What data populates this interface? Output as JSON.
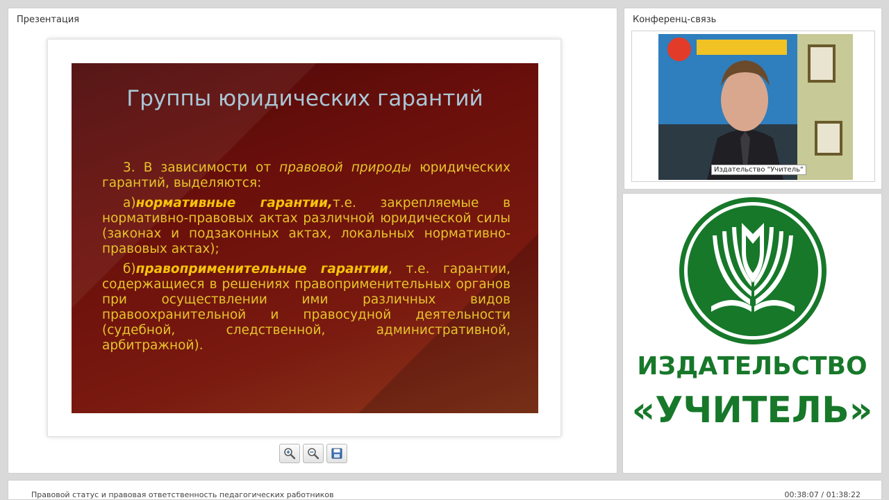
{
  "presentation": {
    "title": "Презентация",
    "slide": {
      "title": "Группы юридических гарантий",
      "intro_num": "3. В зависимости от ",
      "intro_italic": "правовой природы",
      "intro_rest": " юридических гарантий, выделяются:",
      "a_prefix": "а)",
      "a_bold": "нормативные гарантии,",
      "a_rest": "т.е. закрепляемые в нормативно-правовых актах различной юридической силы (законах и подзаконных актах, локальных нормативно-правовых актах);",
      "b_prefix": "б)",
      "b_bold": "правоприменительные гарантии",
      "b_rest": ", т.е. гарантии, содержащиеся в решениях правоприменительных органов при осуществлении ими различных видов правоохранительной и правосудной деятельности (судебной, следственной, административной, арбитражной)."
    },
    "controls": {
      "zoom_in_icon": "zoom-in-icon",
      "zoom_out_icon": "zoom-out-icon",
      "save_icon": "floppy-disk-icon"
    }
  },
  "conference": {
    "title": "Конференц-связь",
    "caption": "Издательство \"Учитель\""
  },
  "publisher": {
    "name": "ИЗДАТЕЛЬСТВО",
    "brand": "«УЧИТЕЛЬ»",
    "logo_icon": "book-logo-icon",
    "color": "#17782a"
  },
  "footer": {
    "lecture_title": "Правовой статус и правовая ответственность педагогических работников",
    "time": "00:38:07 / 01:38:22"
  }
}
